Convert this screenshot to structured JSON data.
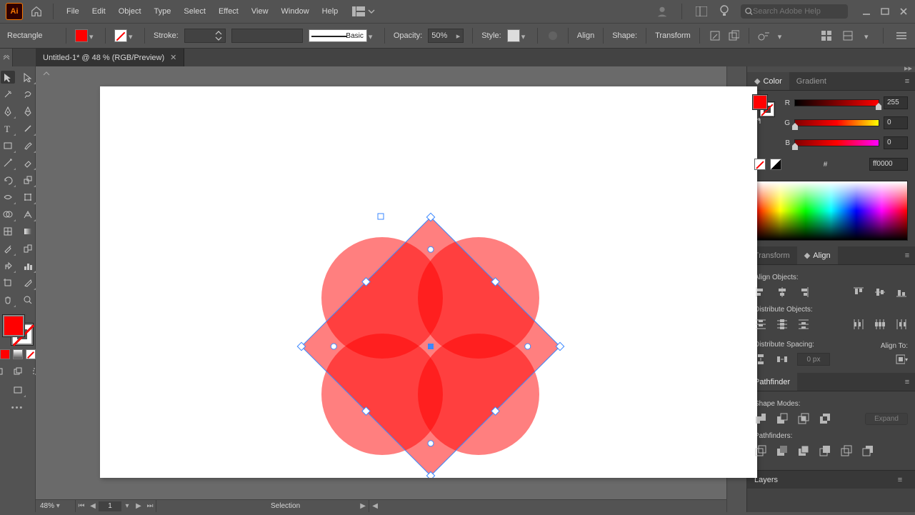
{
  "app": {
    "name": "Ai"
  },
  "menu": [
    "File",
    "Edit",
    "Object",
    "Type",
    "Select",
    "Effect",
    "View",
    "Window",
    "Help"
  ],
  "search": {
    "placeholder": "Search Adobe Help"
  },
  "control": {
    "selection_label": "Rectangle",
    "stroke_label": "Stroke:",
    "brush_label": "Basic",
    "opacity_label": "Opacity:",
    "opacity_value": "50%",
    "style_label": "Style:",
    "align_label": "Align",
    "shape_label": "Shape:",
    "transform_label": "Transform"
  },
  "doc_tab": {
    "title": "Untitled-1* @ 48 % (RGB/Preview)"
  },
  "status": {
    "zoom": "48%",
    "page": "1",
    "tool": "Selection"
  },
  "panels": {
    "color": {
      "tabs": [
        "Color",
        "Gradient"
      ],
      "r_label": "R",
      "r_value": "255",
      "g_label": "G",
      "g_value": "0",
      "b_label": "B",
      "b_value": "0",
      "hash": "#",
      "hex": "ff0000"
    },
    "align": {
      "tabs": [
        "Transform",
        "Align"
      ],
      "align_objects": "Align Objects:",
      "dist_objects": "Distribute Objects:",
      "dist_spacing": "Distribute Spacing:",
      "align_to": "Align To:",
      "spacing_val": "0 px"
    },
    "pathfinder": {
      "tab": "Pathfinder",
      "shape_modes": "Shape Modes:",
      "pathfinders": "Pathfinders:",
      "expand": "Expand"
    },
    "layers": {
      "tab": "Layers"
    }
  }
}
